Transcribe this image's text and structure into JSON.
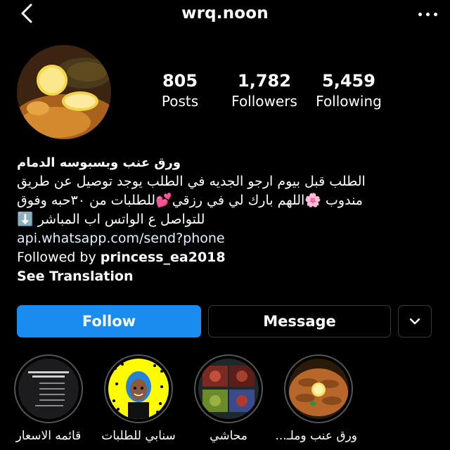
{
  "header": {
    "username": "wrq.noon",
    "back_icon": "chevron-left-icon",
    "more_icon": "more-horizontal-icon"
  },
  "profile": {
    "posts_count": "805",
    "posts_label": "Posts",
    "followers_count": "1,782",
    "followers_label": "Followers",
    "following_count": "5,459",
    "following_label": "Following"
  },
  "bio": {
    "name": "ورق عنب وبسبوسه الدمام",
    "line1": "الطلب قبل بيوم ارجو الجديه في الطلب يوجد توصيل عن طريق",
    "line2": "مندوب 🌸اللهم بارك لي في رزقي💕للطلبات من ٣٠حبه وفوق",
    "line3": "للتواصل ع الواتس اب المباشر ⬇️",
    "link": "api.whatsapp.com/send?phone",
    "followed_by_prefix": "Followed by ",
    "followed_by_user": "princess_ea2018",
    "see_translation": "See Translation"
  },
  "actions": {
    "follow_label": "Follow",
    "message_label": "Message",
    "dropdown_icon": "chevron-down-icon",
    "follow_color": "#1a8cf0"
  },
  "highlights": [
    {
      "label": "قائمه الاسعار"
    },
    {
      "label": "سنابي للطلبات"
    },
    {
      "label": "محاشي"
    },
    {
      "label": "ورق عنب وملـ..."
    }
  ]
}
